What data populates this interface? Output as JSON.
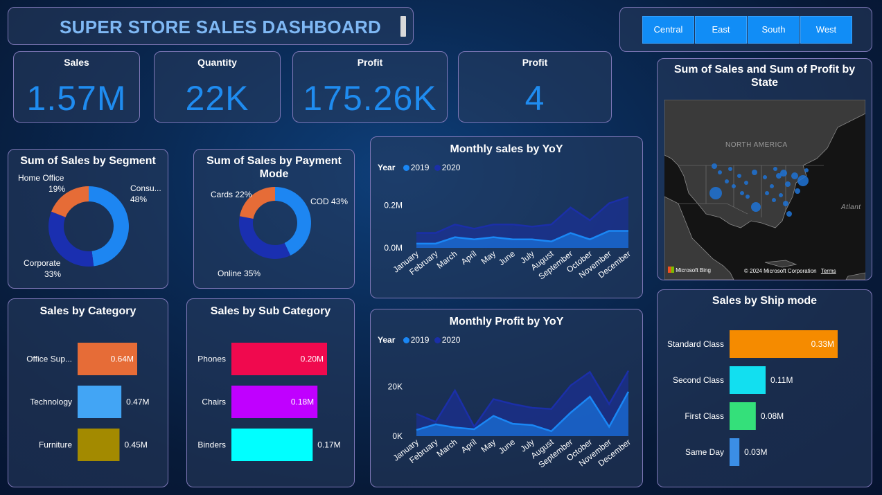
{
  "header": {
    "title": "SUPER STORE SALES DASHBOARD"
  },
  "regions": [
    "Central",
    "East",
    "South",
    "West"
  ],
  "kpis": [
    {
      "label": "Sales",
      "value": "1.57M"
    },
    {
      "label": "Quantity",
      "value": "22K"
    },
    {
      "label": "Profit",
      "value": "175.26K"
    },
    {
      "label": "Profit",
      "value": "4"
    }
  ],
  "colors": {
    "accent": "#1f8cf0",
    "series_2019": "#1a87f5",
    "series_2020": "#1b2fa8"
  },
  "chart_data": [
    {
      "id": "segment",
      "type": "pie",
      "title": "Sum of Sales by Segment",
      "categories": [
        "Consu...",
        "Corporate",
        "Home Office"
      ],
      "values": [
        48,
        33,
        19
      ],
      "labels": [
        "48%",
        "33%",
        "19%"
      ],
      "colors": [
        "#1d86f2",
        "#1a2fb0",
        "#e66c37"
      ]
    },
    {
      "id": "payment",
      "type": "pie",
      "title": "Sum of Sales by Payment Mode",
      "categories": [
        "COD",
        "Online",
        "Cards"
      ],
      "values": [
        43,
        35,
        22
      ],
      "labels": [
        "43%",
        "35%",
        "22%"
      ],
      "colors": [
        "#1d86f2",
        "#1a2fb0",
        "#e66c37"
      ]
    },
    {
      "id": "monthly_sales",
      "type": "area",
      "title": "Monthly sales by YoY",
      "legend_title": "Year",
      "categories": [
        "January",
        "February",
        "March",
        "April",
        "May",
        "June",
        "July",
        "August",
        "September",
        "October",
        "November",
        "December"
      ],
      "series": [
        {
          "name": "2019",
          "values": [
            0.02,
            0.02,
            0.05,
            0.04,
            0.05,
            0.04,
            0.04,
            0.03,
            0.07,
            0.04,
            0.08,
            0.08
          ]
        },
        {
          "name": "2020",
          "values": [
            0.07,
            0.07,
            0.11,
            0.09,
            0.11,
            0.11,
            0.1,
            0.11,
            0.19,
            0.13,
            0.21,
            0.24
          ]
        }
      ],
      "yticks": [
        "0.0M",
        "0.2M"
      ],
      "ylim": [
        0,
        0.3
      ]
    },
    {
      "id": "monthly_profit",
      "type": "area",
      "title": "Monthly Profit by YoY",
      "legend_title": "Year",
      "categories": [
        "January",
        "February",
        "March",
        "April",
        "May",
        "June",
        "July",
        "August",
        "September",
        "October",
        "November",
        "December"
      ],
      "series": [
        {
          "name": "2019",
          "values": [
            2500,
            4800,
            3500,
            2800,
            8200,
            5000,
            4500,
            2000,
            9500,
            16000,
            3800,
            18000
          ]
        },
        {
          "name": "2020",
          "values": [
            9000,
            5800,
            18500,
            3800,
            15000,
            13000,
            11500,
            11000,
            20500,
            26000,
            13000,
            26500
          ]
        }
      ],
      "yticks": [
        "0K",
        "20K"
      ],
      "ylim": [
        0,
        30000
      ]
    },
    {
      "id": "category",
      "type": "bar",
      "orientation": "horizontal",
      "title": "Sales by Category",
      "categories": [
        "Office Sup...",
        "Technology",
        "Furniture"
      ],
      "values": [
        0.64,
        0.47,
        0.45
      ],
      "labels": [
        "0.64M",
        "0.47M",
        "0.45M"
      ],
      "colors": [
        "#e66c37",
        "#42a5f5",
        "#a38a00"
      ]
    },
    {
      "id": "subcategory",
      "type": "bar",
      "orientation": "horizontal",
      "title": "Sales by Sub Category",
      "categories": [
        "Phones",
        "Chairs",
        "Binders"
      ],
      "values": [
        0.2,
        0.18,
        0.17
      ],
      "labels": [
        "0.20M",
        "0.18M",
        "0.17M"
      ],
      "colors": [
        "#f0094e",
        "#c000ff",
        "#00ffff"
      ]
    },
    {
      "id": "shipmode",
      "type": "bar",
      "orientation": "horizontal",
      "title": "Sales by Ship mode",
      "categories": [
        "Standard Class",
        "Second Class",
        "First Class",
        "Same Day"
      ],
      "values": [
        0.33,
        0.11,
        0.08,
        0.03
      ],
      "labels": [
        "0.33M",
        "0.11M",
        "0.08M",
        "0.03M"
      ],
      "colors": [
        "#f58b00",
        "#12dff0",
        "#34e07a",
        "#3b8ee6"
      ]
    }
  ],
  "map": {
    "title": "Sum of Sales and Sum of Profit by State",
    "region_label": "NORTH AMERICA",
    "ocean_label": "Atlant",
    "attribution": "Microsoft Bing",
    "copyright": "© 2024 Microsoft Corporation",
    "terms": "Terms"
  }
}
